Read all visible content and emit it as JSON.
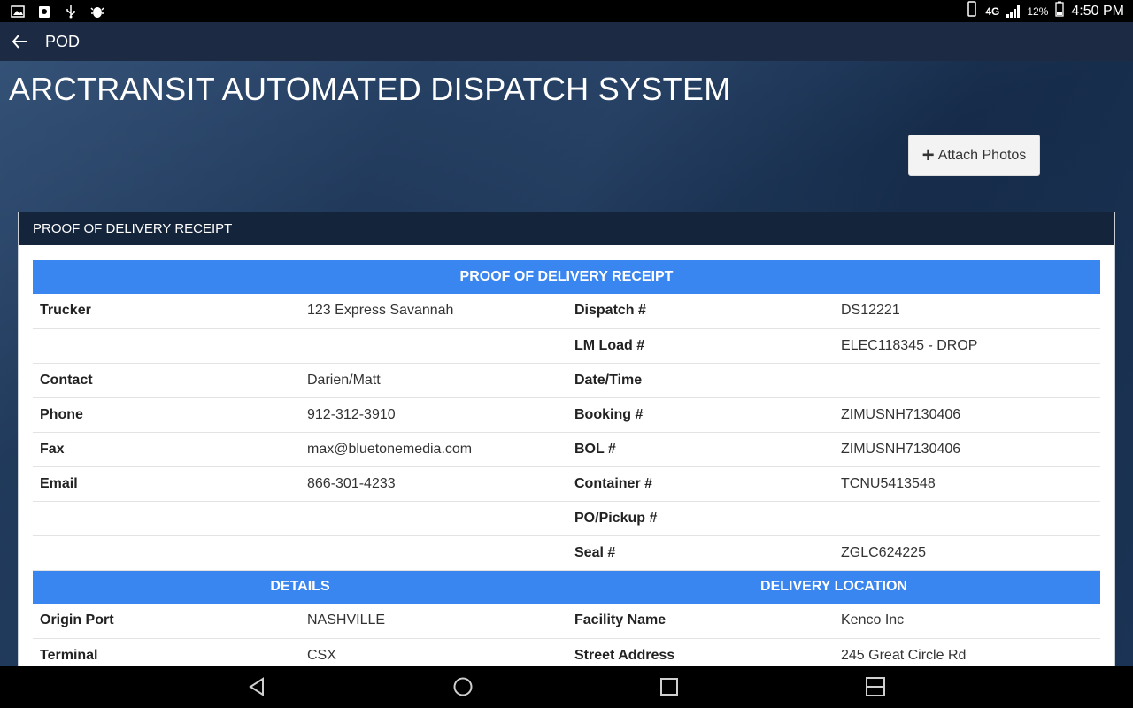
{
  "status_bar": {
    "time": "4:50 PM",
    "battery": "12%",
    "network": "4G",
    "icons": [
      "image-icon",
      "clipboard-icon",
      "usb-icon",
      "android-debug-icon"
    ]
  },
  "app_bar": {
    "title": "POD",
    "back_icon": "arrow-left-icon"
  },
  "page": {
    "title": "ARCTRANSIT AUTOMATED DISPATCH SYSTEM",
    "attach_button_label": "Attach Photos"
  },
  "panel": {
    "header": "PROOF OF DELIVERY RECEIPT",
    "section1_title": "PROOF OF DELIVERY RECEIPT",
    "rows": [
      {
        "l1": "Trucker",
        "v1": "123 Express Savannah",
        "l2": "Dispatch #",
        "v2": "DS12221"
      },
      {
        "l1": "",
        "v1": "",
        "l2": "LM Load #",
        "v2": "ELEC118345 - DROP"
      },
      {
        "l1": "Contact",
        "v1": "Darien/Matt",
        "l2": "Date/Time",
        "v2": ""
      },
      {
        "l1": "Phone",
        "v1": "912-312-3910",
        "l2": "Booking #",
        "v2": "ZIMUSNH7130406"
      },
      {
        "l1": "Fax",
        "v1": "max@bluetonemedia.com",
        "l2": "BOL #",
        "v2": "ZIMUSNH7130406"
      },
      {
        "l1": "Email",
        "v1": "866-301-4233",
        "l2": "Container #",
        "v2": "TCNU5413548"
      },
      {
        "l1": "",
        "v1": "",
        "l2": "PO/Pickup #",
        "v2": ""
      },
      {
        "l1": "",
        "v1": "",
        "l2": "Seal #",
        "v2": "ZGLC624225"
      }
    ],
    "section2_left_title": "DETAILS",
    "section2_right_title": "DELIVERY LOCATION",
    "rows2": [
      {
        "l1": "Origin Port",
        "v1": "NASHVILLE",
        "l2": "Facility Name",
        "v2": "Kenco Inc"
      },
      {
        "l1": "Terminal",
        "v1": "CSX",
        "l2": "Street Address",
        "v2": "245 Great Circle Rd"
      }
    ]
  },
  "nav_bar": {
    "buttons": [
      "back-triangle-icon",
      "home-circle-icon",
      "recents-square-icon",
      "split-screen-icon"
    ]
  },
  "colors": {
    "accent_blue": "#3a86f0",
    "panel_header": "#14243b",
    "app_bar": "#1c2b43"
  }
}
